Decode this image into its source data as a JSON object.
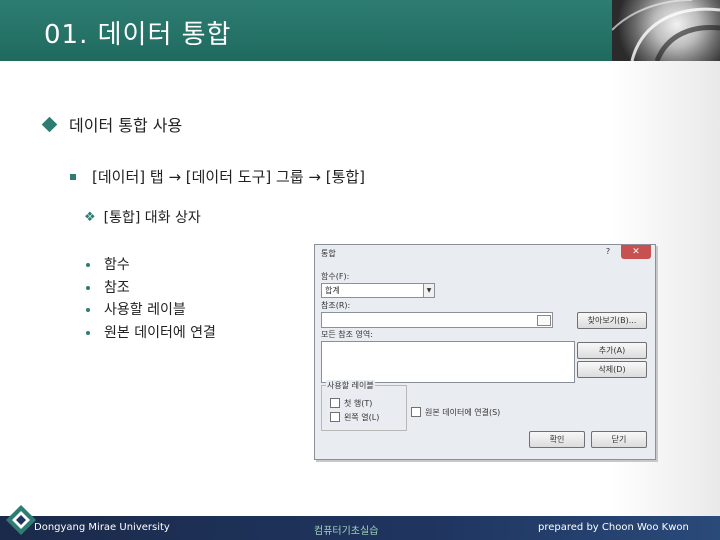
{
  "header": {
    "title": "01. 데이터 통합"
  },
  "bullets": {
    "level1": "데이터 통합 사용",
    "level2": "[데이터] 탭 → [데이터 도구] 그룹 → [통합]",
    "level3": "[통합] 대화 상자",
    "level4": [
      "함수",
      "참조",
      "사용할 레이블",
      "원본 데이터에 연결"
    ]
  },
  "dialog": {
    "title": "통합",
    "help": "?",
    "close": "✕",
    "function_label": "함수(F):",
    "function_value": "합계",
    "reference_label": "참조(R):",
    "all_references_label": "모든 참조 영역:",
    "browse_button": "찾아보기(B)...",
    "add_button": "추가(A)",
    "delete_button": "삭제(D)",
    "use_labels_group": "사용할 레이블",
    "top_row_label": "첫 행(T)",
    "left_column_label": "왼쪽 열(L)",
    "link_source_label": "원본 데이터에 연결(S)",
    "ok_button": "확인",
    "close_button": "닫기"
  },
  "footer": {
    "left": "Dongyang Mirae University",
    "center": "컴퓨터기초실습",
    "right": "prepared by Choon Woo Kwon"
  },
  "colors": {
    "accent": "#2e7d72",
    "footer": "#1f3560"
  }
}
